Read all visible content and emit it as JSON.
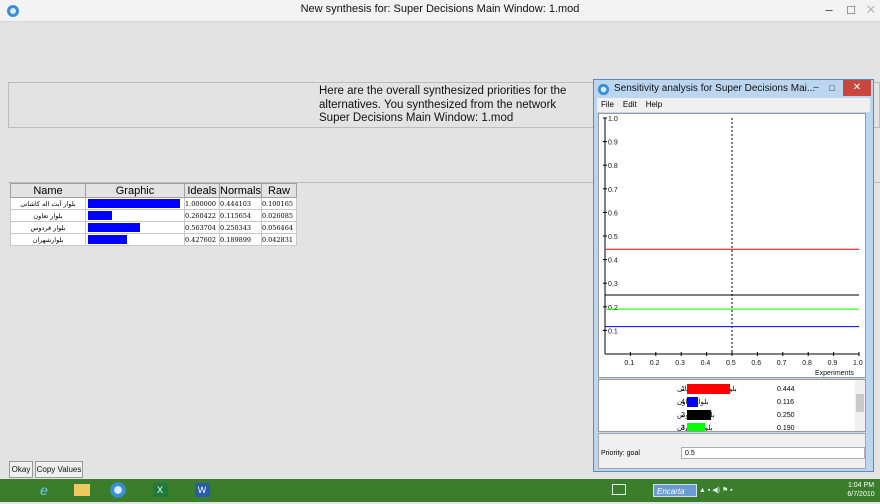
{
  "window": {
    "title": "New synthesis for: Super Decisions Main Window: 1.mod"
  },
  "message": {
    "line1": "Here are the overall synthesized priorities for the",
    "line2": "alternatives.  You synthesized from the network",
    "line3": "Super Decisions Main Window: 1.mod"
  },
  "table": {
    "headers": {
      "name": "Name",
      "graphic": "Graphic",
      "ideals": "Ideals",
      "normals": "Normals",
      "raw": "Raw"
    },
    "rows": [
      {
        "name": "بلوار آیت اله کاشانی",
        "ideal": "1.000000",
        "normal": "0.444103",
        "raw": "0.100165",
        "fill": 1.0
      },
      {
        "name": "بلوار تعاون",
        "ideal": "0.260422",
        "normal": "0.115654",
        "raw": "0.026085",
        "fill": 0.260422
      },
      {
        "name": "بلوار فردوس",
        "ideal": "0.563704",
        "normal": "0.250343",
        "raw": "0.056464",
        "fill": 0.563704
      },
      {
        "name": "بلوارشهران",
        "ideal": "0.427602",
        "normal": "0.189899",
        "raw": "0.042831",
        "fill": 0.427602
      }
    ]
  },
  "buttons": {
    "okay": "Okay",
    "copy": "Copy Values"
  },
  "sensitivity": {
    "title": "Sensitivity analysis for Super Decisions Mai...",
    "menu": {
      "file": "File",
      "edit": "Edit",
      "help": "Help"
    },
    "x_label": "Experiments",
    "status_label": "Priority: goal",
    "status_value": "0.5",
    "list": [
      {
        "name": "بلوار آیت اله کاشانی",
        "rank": "1",
        "value": "0.444",
        "color": "#ff0000",
        "fill": 0.444
      },
      {
        "name": "بلوار تعاون",
        "rank": "4",
        "value": "0.116",
        "color": "#0000ff",
        "fill": 0.116
      },
      {
        "name": "بلوار فردوس",
        "rank": "2",
        "value": "0.250",
        "color": "#000000",
        "fill": 0.25
      },
      {
        "name": "بلوار شهران",
        "rank": "3",
        "value": "0.190",
        "color": "#00ff00",
        "fill": 0.19
      }
    ]
  },
  "chart_data": {
    "type": "line",
    "xlabel": "Experiments",
    "xlim": [
      0,
      1.0
    ],
    "ylim": [
      0,
      1.0
    ],
    "x_ticks": [
      "0.1",
      "0.2",
      "0.3",
      "0.4",
      "0.5",
      "0.6",
      "0.7",
      "0.8",
      "0.9",
      "1.0"
    ],
    "y_ticks": [
      "0.1",
      "0.2",
      "0.3",
      "0.4",
      "0.5",
      "0.6",
      "0.7",
      "0.8",
      "0.9",
      "1.0"
    ],
    "marker_x": 0.5,
    "series": [
      {
        "color": "#ff0000",
        "x": [
          0,
          1.0
        ],
        "y": [
          0.444,
          0.444
        ]
      },
      {
        "color": "#000000",
        "x": [
          0,
          1.0
        ],
        "y": [
          0.25,
          0.25
        ]
      },
      {
        "color": "#00ff00",
        "x": [
          0,
          1.0
        ],
        "y": [
          0.19,
          0.19
        ]
      },
      {
        "color": "#0000ff",
        "x": [
          0,
          1.0
        ],
        "y": [
          0.116,
          0.116
        ]
      }
    ]
  },
  "taskbar": {
    "time": "1:04 PM",
    "date": "6/7/2010",
    "encarta": "Encarta"
  }
}
